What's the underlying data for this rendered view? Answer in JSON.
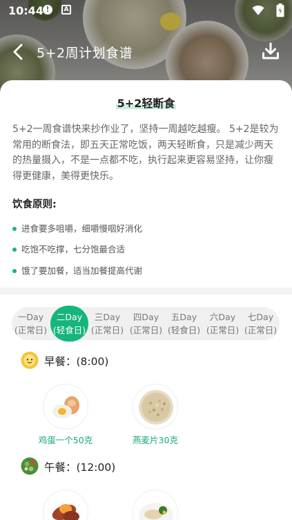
{
  "status_bar": {
    "time": "10:44",
    "icons": [
      "alert-icon",
      "a-icon",
      "wifi-icon",
      "battery-icon"
    ],
    "alert_glyph": "!",
    "a_glyph": "A"
  },
  "header": {
    "title": "5+2周计划食谱",
    "back_icon": "chevron-left-icon",
    "download_icon": "download-icon"
  },
  "intro": {
    "title": "5+2轻断食",
    "text": "5+2一周食谱快来抄作业了，坚持一周越吃越瘦。 5+2是较为常用的断食法，即五天正常吃饭，两天轻断食，只是减少两天的热量摄入，不是一点都不吃，执行起来更容易坚持，让你瘦得更健康，美得更快乐。"
  },
  "principles": {
    "title": "饮食原则:",
    "items": [
      "进食要多咀嚼，细嚼慢咽好消化",
      "吃饱不吃撑，七分饱最合适",
      "饿了要加餐，适当加餐提高代谢"
    ]
  },
  "day_tabs": [
    {
      "day": "一Day",
      "type": "(正常日)",
      "active": false
    },
    {
      "day": "二Day",
      "type": "(轻食日)",
      "active": true
    },
    {
      "day": "三Day",
      "type": "(正常日)",
      "active": false
    },
    {
      "day": "四Day",
      "type": "(正常日)",
      "active": false
    },
    {
      "day": "五Day",
      "type": "(轻食日)",
      "active": false
    },
    {
      "day": "六Day",
      "type": "(正常日)",
      "active": false
    },
    {
      "day": "七Day",
      "type": "(正常日)",
      "active": false
    }
  ],
  "meals": [
    {
      "label": "早餐：(8:00)",
      "icon": "sun-icon",
      "foods": [
        {
          "name": "鸡蛋一个50克",
          "icon": "eggs-icon"
        },
        {
          "name": "燕麦片30克",
          "icon": "oats-icon"
        }
      ]
    },
    {
      "label": "午餐：(12:00)",
      "icon": "salad-icon",
      "foods": [
        {
          "name": "",
          "icon": "sweet-potato-icon"
        },
        {
          "name": "",
          "icon": "chicken-plate-icon"
        }
      ]
    }
  ],
  "colors": {
    "accent": "#16b57b",
    "accent_text": "#17ab75",
    "highlight": "#cdeedd"
  }
}
